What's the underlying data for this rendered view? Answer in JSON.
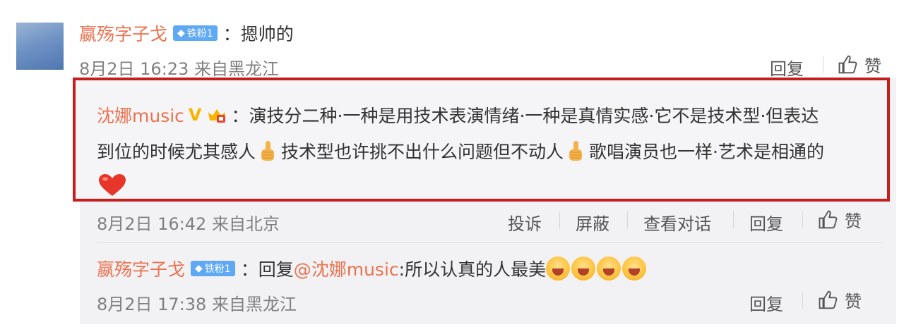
{
  "comment1": {
    "username": "嬴殇字子戈",
    "badge": "铁粉1",
    "text": "：摁帅的",
    "time": "8月2日 16:23 来自黑龙江",
    "reply": "回复",
    "like": "赞"
  },
  "comment2": {
    "username": "沈娜music",
    "text_line1": "：演技分二种·一种是用技术表演情绪·一种是真情实感·它不是技术型·但表达",
    "text_line2_a": "到位的时候尤其感人",
    "text_line2_b": "技术型也许挑不出什么问题但不动人",
    "text_line2_c": "歌唱演员也一样·艺术是相通的",
    "time": "8月2日 16:42 来自北京",
    "complain": "投诉",
    "block": "屏蔽",
    "view_conversation": "查看对话",
    "reply": "回复",
    "like": "赞"
  },
  "comment3": {
    "username": "嬴殇字子戈",
    "badge": "铁粉1",
    "text_prefix": "：回复",
    "mention": "@沈娜music",
    "text_suffix": ":所以认真的人最美",
    "time": "8月2日 17:38 来自黑龙江",
    "reply": "回复",
    "like": "赞"
  },
  "colors": {
    "username": "#eb7350",
    "highlight_border": "#c61d1d",
    "badge_bg": "#5ea8f5"
  }
}
